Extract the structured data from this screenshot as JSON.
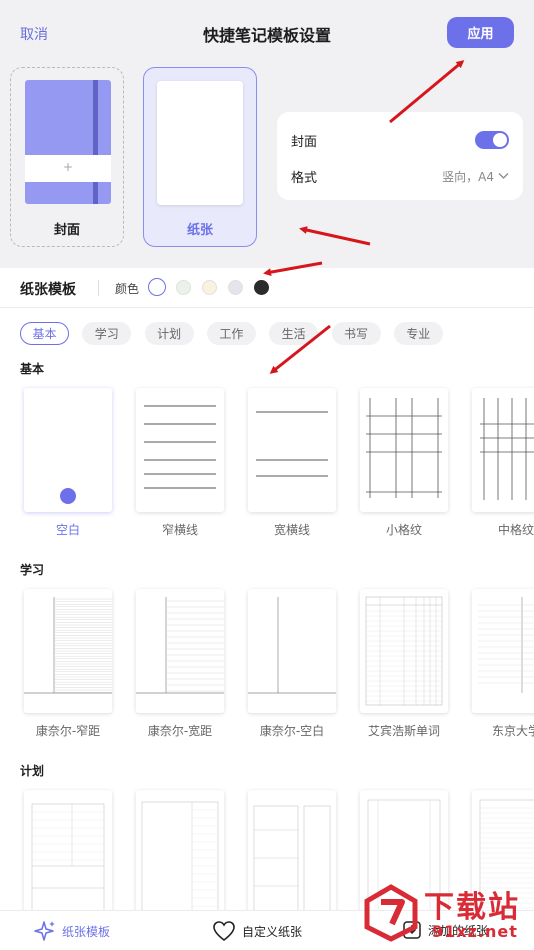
{
  "header": {
    "cancel": "取消",
    "title": "快捷笔记模板设置",
    "apply": "应用"
  },
  "preview": {
    "cover_label": "封面",
    "cover_plus": "+",
    "paper_label": "纸张"
  },
  "settings": {
    "cover_label": "封面",
    "cover_on": true,
    "format_label": "格式",
    "format_value": "竖向，A4"
  },
  "template_bar": {
    "title": "纸张模板",
    "color_label": "颜色",
    "swatches": [
      "#ffffff",
      "#e9f3ea",
      "#fbf1df",
      "#e4e4ec",
      "#2b2b2b"
    ],
    "selected_swatch": 0
  },
  "categories": [
    "基本",
    "学习",
    "计划",
    "工作",
    "生活",
    "书写",
    "专业"
  ],
  "active_category": 0,
  "sections": {
    "basic": {
      "title": "基本",
      "items": [
        "空白",
        "窄横线",
        "宽横线",
        "小格纹",
        "中格纹"
      ]
    },
    "study": {
      "title": "学习",
      "items": [
        "康奈尔-窄距",
        "康奈尔-宽距",
        "康奈尔-空白",
        "艾宾浩斯单词",
        "东京大学"
      ]
    },
    "plan": {
      "title": "计划"
    }
  },
  "bottom": {
    "templates": "纸张模板",
    "custom": "自定义纸张",
    "add": "添加的纸张"
  },
  "watermark": {
    "main": "下载站",
    "sub": "91xz.net"
  },
  "colors": {
    "accent": "#6d71e9",
    "arrow": "#d6151c"
  }
}
